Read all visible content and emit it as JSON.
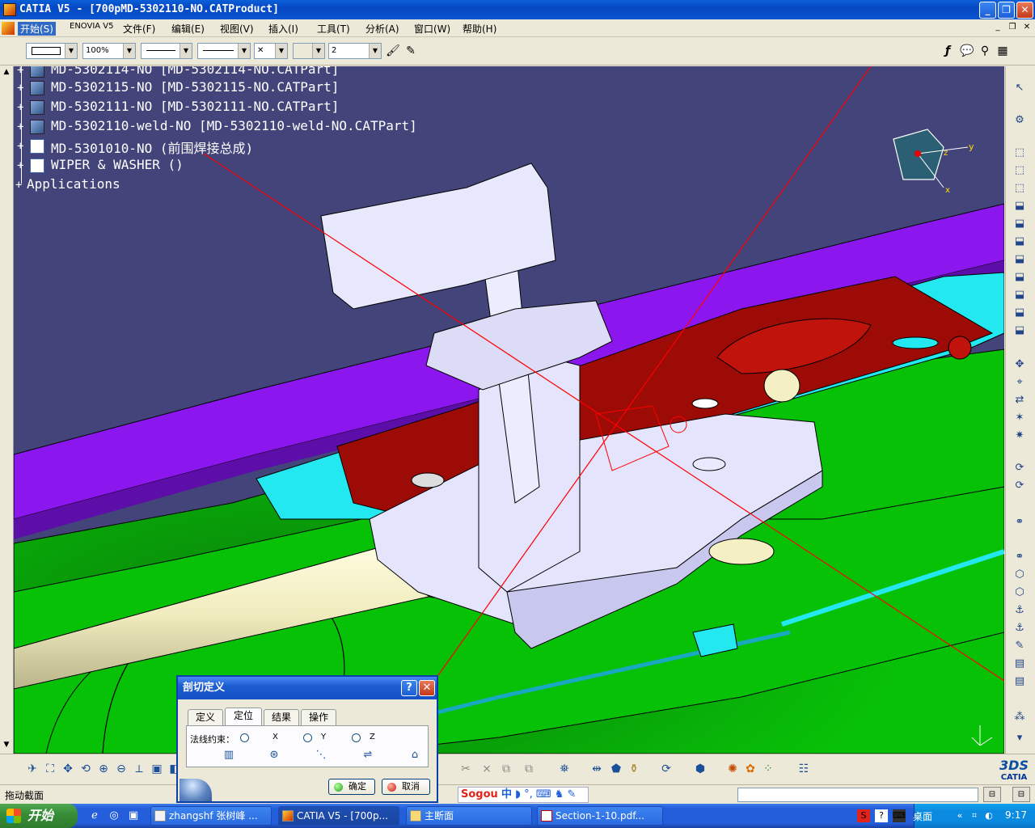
{
  "window": {
    "title": "CATIA V5 - [700pMD-5302110-NO.CATProduct]",
    "controls": {
      "minimize": "_",
      "restore": "❐",
      "close": "✕"
    }
  },
  "menu": {
    "items": [
      "开始(S)",
      "ENOVIA V5",
      "文件(F)",
      "编辑(E)",
      "视图(V)",
      "插入(I)",
      "工具(T)",
      "分析(A)",
      "窗口(W)",
      "帮助(H)"
    ],
    "mdi": {
      "minimize": "_",
      "restore": "❐",
      "close": "✕"
    }
  },
  "properties_toolbar": {
    "transparency": "100%",
    "point_type": "✕",
    "layer": "2"
  },
  "tree": {
    "nodes": [
      {
        "label": "MD-5302114-NO [MD-5302114-NO.CATPart]",
        "type": "part"
      },
      {
        "label": "MD-5302115-NO [MD-5302115-NO.CATPart]",
        "type": "part"
      },
      {
        "label": "MD-5302111-NO [MD-5302111-NO.CATPart]",
        "type": "part"
      },
      {
        "label": "MD-5302110-weld-NO [MD-5302110-weld-NO.CATPart]",
        "type": "part"
      },
      {
        "label": "MD-5301010-NO (前围焊接总成)",
        "type": "product"
      },
      {
        "label": "WIPER & WASHER ()",
        "type": "product"
      },
      {
        "label": "Applications",
        "type": "root"
      }
    ]
  },
  "compass": {
    "x": "x",
    "y": "y",
    "z": "z"
  },
  "section_dialog": {
    "title": "剖切定义",
    "help": "?",
    "close": "✕",
    "tabs": [
      "定义",
      "定位",
      "结果",
      "操作"
    ],
    "active_tab": "定位",
    "normal_constraint_label": "法线约束：",
    "axes": [
      "X",
      "Y",
      "Z"
    ],
    "ok_label": "确定",
    "cancel_label": "取消"
  },
  "status": {
    "message": "拖动截面"
  },
  "ime": {
    "brand": "Sogou",
    "mode": "中"
  },
  "taskbar": {
    "start_label": "开始",
    "tasks": [
      {
        "label": "zhangshf 张树峰 ...",
        "active": false
      },
      {
        "label": "CATIA V5 - [700p...",
        "active": true
      },
      {
        "label": "主断面",
        "active": false
      },
      {
        "label": "Section-1-10.pdf...",
        "active": false
      }
    ],
    "desktop_label": "桌面",
    "clock": "9:17"
  },
  "logo": {
    "text": "CATIA",
    "mark": "3DS"
  },
  "colors": {
    "background": "#43447a",
    "purple_panel": "#8b17ee",
    "green_surface": "#07c107",
    "red_part": "#9c0b06",
    "cyan_part": "#24e8f0",
    "lavender_part": "#d9d9f9",
    "cream_tube": "#f4f0c4",
    "section_line": "#ff0000"
  }
}
